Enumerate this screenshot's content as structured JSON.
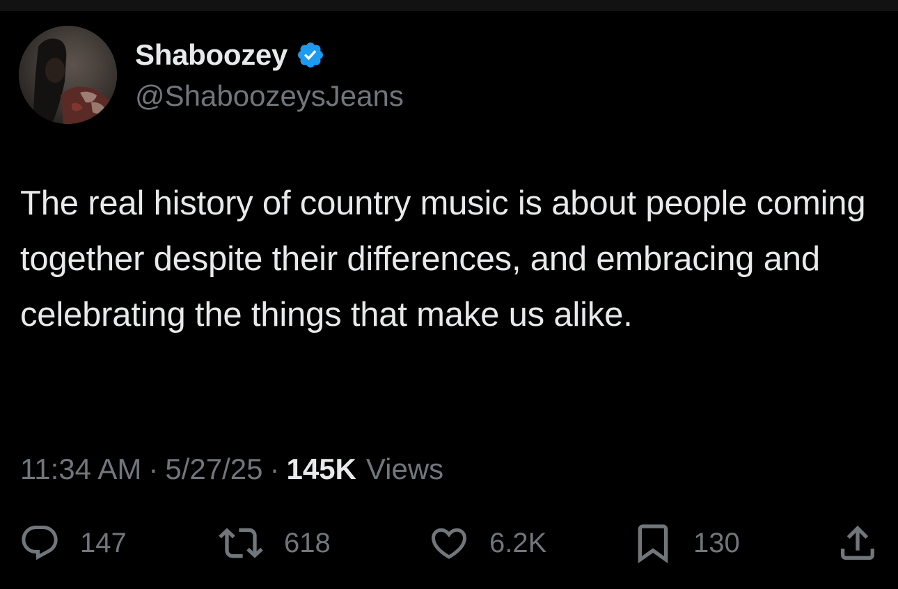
{
  "author": {
    "display_name": "Shaboozey",
    "handle": "@ShaboozeysJeans",
    "verified": true,
    "verified_color": "#1d9bf0"
  },
  "tweet": {
    "text": "The real history of country music is about people coming together despite their differences, and embracing and celebrating the things that make us alike."
  },
  "meta": {
    "time": "11:34 AM",
    "separator": "·",
    "date": "5/27/25",
    "views_count": "145K",
    "views_label": "Views"
  },
  "actions": {
    "replies": "147",
    "reposts": "618",
    "likes": "6.2K",
    "bookmarks": "130"
  },
  "icons": {
    "reply": "reply-icon",
    "repost": "repost-icon",
    "like": "heart-icon",
    "bookmark": "bookmark-icon",
    "share": "share-icon",
    "verified": "verified-badge-icon"
  },
  "colors": {
    "background": "#000000",
    "primary_text": "#e7e9ea",
    "secondary_text": "#71767b"
  }
}
